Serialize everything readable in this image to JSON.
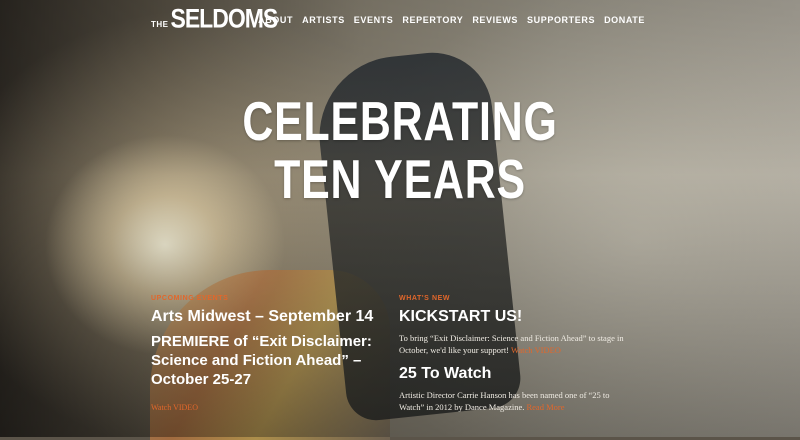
{
  "brand": {
    "the": "THE",
    "name": "SELDOMS"
  },
  "nav": [
    {
      "label": "ABOUT"
    },
    {
      "label": "ARTISTS"
    },
    {
      "label": "EVENTS"
    },
    {
      "label": "REPERTORY"
    },
    {
      "label": "REVIEWS"
    },
    {
      "label": "SUPPORTERS"
    },
    {
      "label": "DONATE"
    }
  ],
  "hero": {
    "line1": "CELEBRATING",
    "line2": "TEN YEARS"
  },
  "upcoming": {
    "eyebrow": "UPCOMING EVENTS",
    "events": [
      {
        "title": "Arts Midwest – September 14"
      },
      {
        "title": "PREMIERE of “Exit Disclaimer: Science and Fiction Ahead” – October 25-27"
      }
    ],
    "link": "Watch VIDEO"
  },
  "news": {
    "eyebrow": "WHAT'S NEW",
    "items": [
      {
        "title": "KICKSTART US!",
        "text": "To bring “Exit Disclaimer: Science and Fiction Ahead” to stage in October, we'd like your support!",
        "link": "Watch VIDEO"
      },
      {
        "title": "25 To Watch",
        "text": "Artistic Director Carrie Hanson has been named one of “25 to Watch” in 2012 by Dance Magazine.",
        "link": "Read More"
      }
    ]
  },
  "colors": {
    "accent": "#e2672b",
    "text": "#ffffff"
  }
}
